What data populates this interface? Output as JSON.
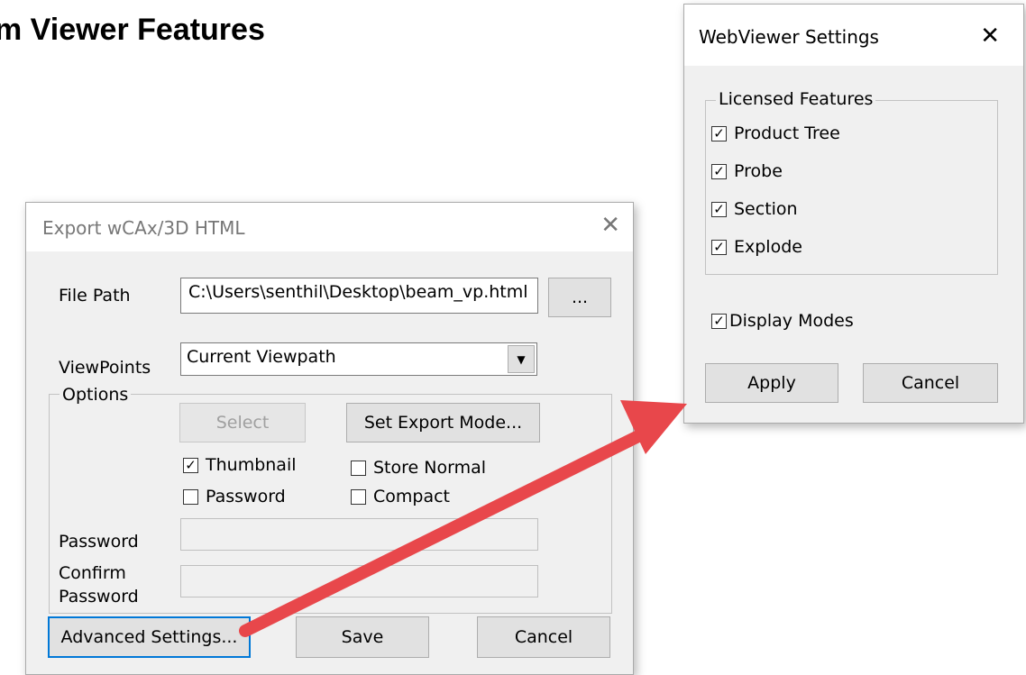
{
  "page_heading": "m Viewer Features",
  "export_dialog": {
    "title": "Export wCAx/3D HTML",
    "close_glyph": "✕",
    "file_path_label": "File Path",
    "file_path_value": "C:\\Users\\senthil\\Desktop\\beam_vp.html",
    "browse_label": "...",
    "viewpoints_label": "ViewPoints",
    "viewpoints_selected": "Current Viewpath",
    "options_legend": "Options",
    "select_label": "Select",
    "set_export_mode_label": "Set Export Mode...",
    "checkboxes": [
      {
        "label": "Thumbnail",
        "checked": true
      },
      {
        "label": "Store Normal",
        "checked": false
      },
      {
        "label": "Password",
        "checked": false
      },
      {
        "label": "Compact",
        "checked": false
      }
    ],
    "password_label": "Password",
    "password_value": "",
    "confirm_label_line1": "Confirm",
    "confirm_label_line2": "Password",
    "confirm_value": "",
    "advanced_settings_label": "Advanced Settings...",
    "save_label": "Save",
    "cancel_label": "Cancel"
  },
  "webviewer_dialog": {
    "title": "WebViewer Settings",
    "close_glyph": "✕",
    "licensed_legend": "Licensed Features",
    "features": [
      {
        "label": "Product Tree",
        "checked": true
      },
      {
        "label": "Probe",
        "checked": true
      },
      {
        "label": "Section",
        "checked": true
      },
      {
        "label": "Explode",
        "checked": true
      }
    ],
    "display_modes_label": "Display Modes",
    "display_modes_checked": true,
    "apply_label": "Apply",
    "cancel_label": "Cancel"
  },
  "check_glyph": "✓",
  "colors": {
    "arrow": "#e8474b",
    "dialog_bg": "#f0f0f0",
    "focus_border": "#0078d7"
  }
}
